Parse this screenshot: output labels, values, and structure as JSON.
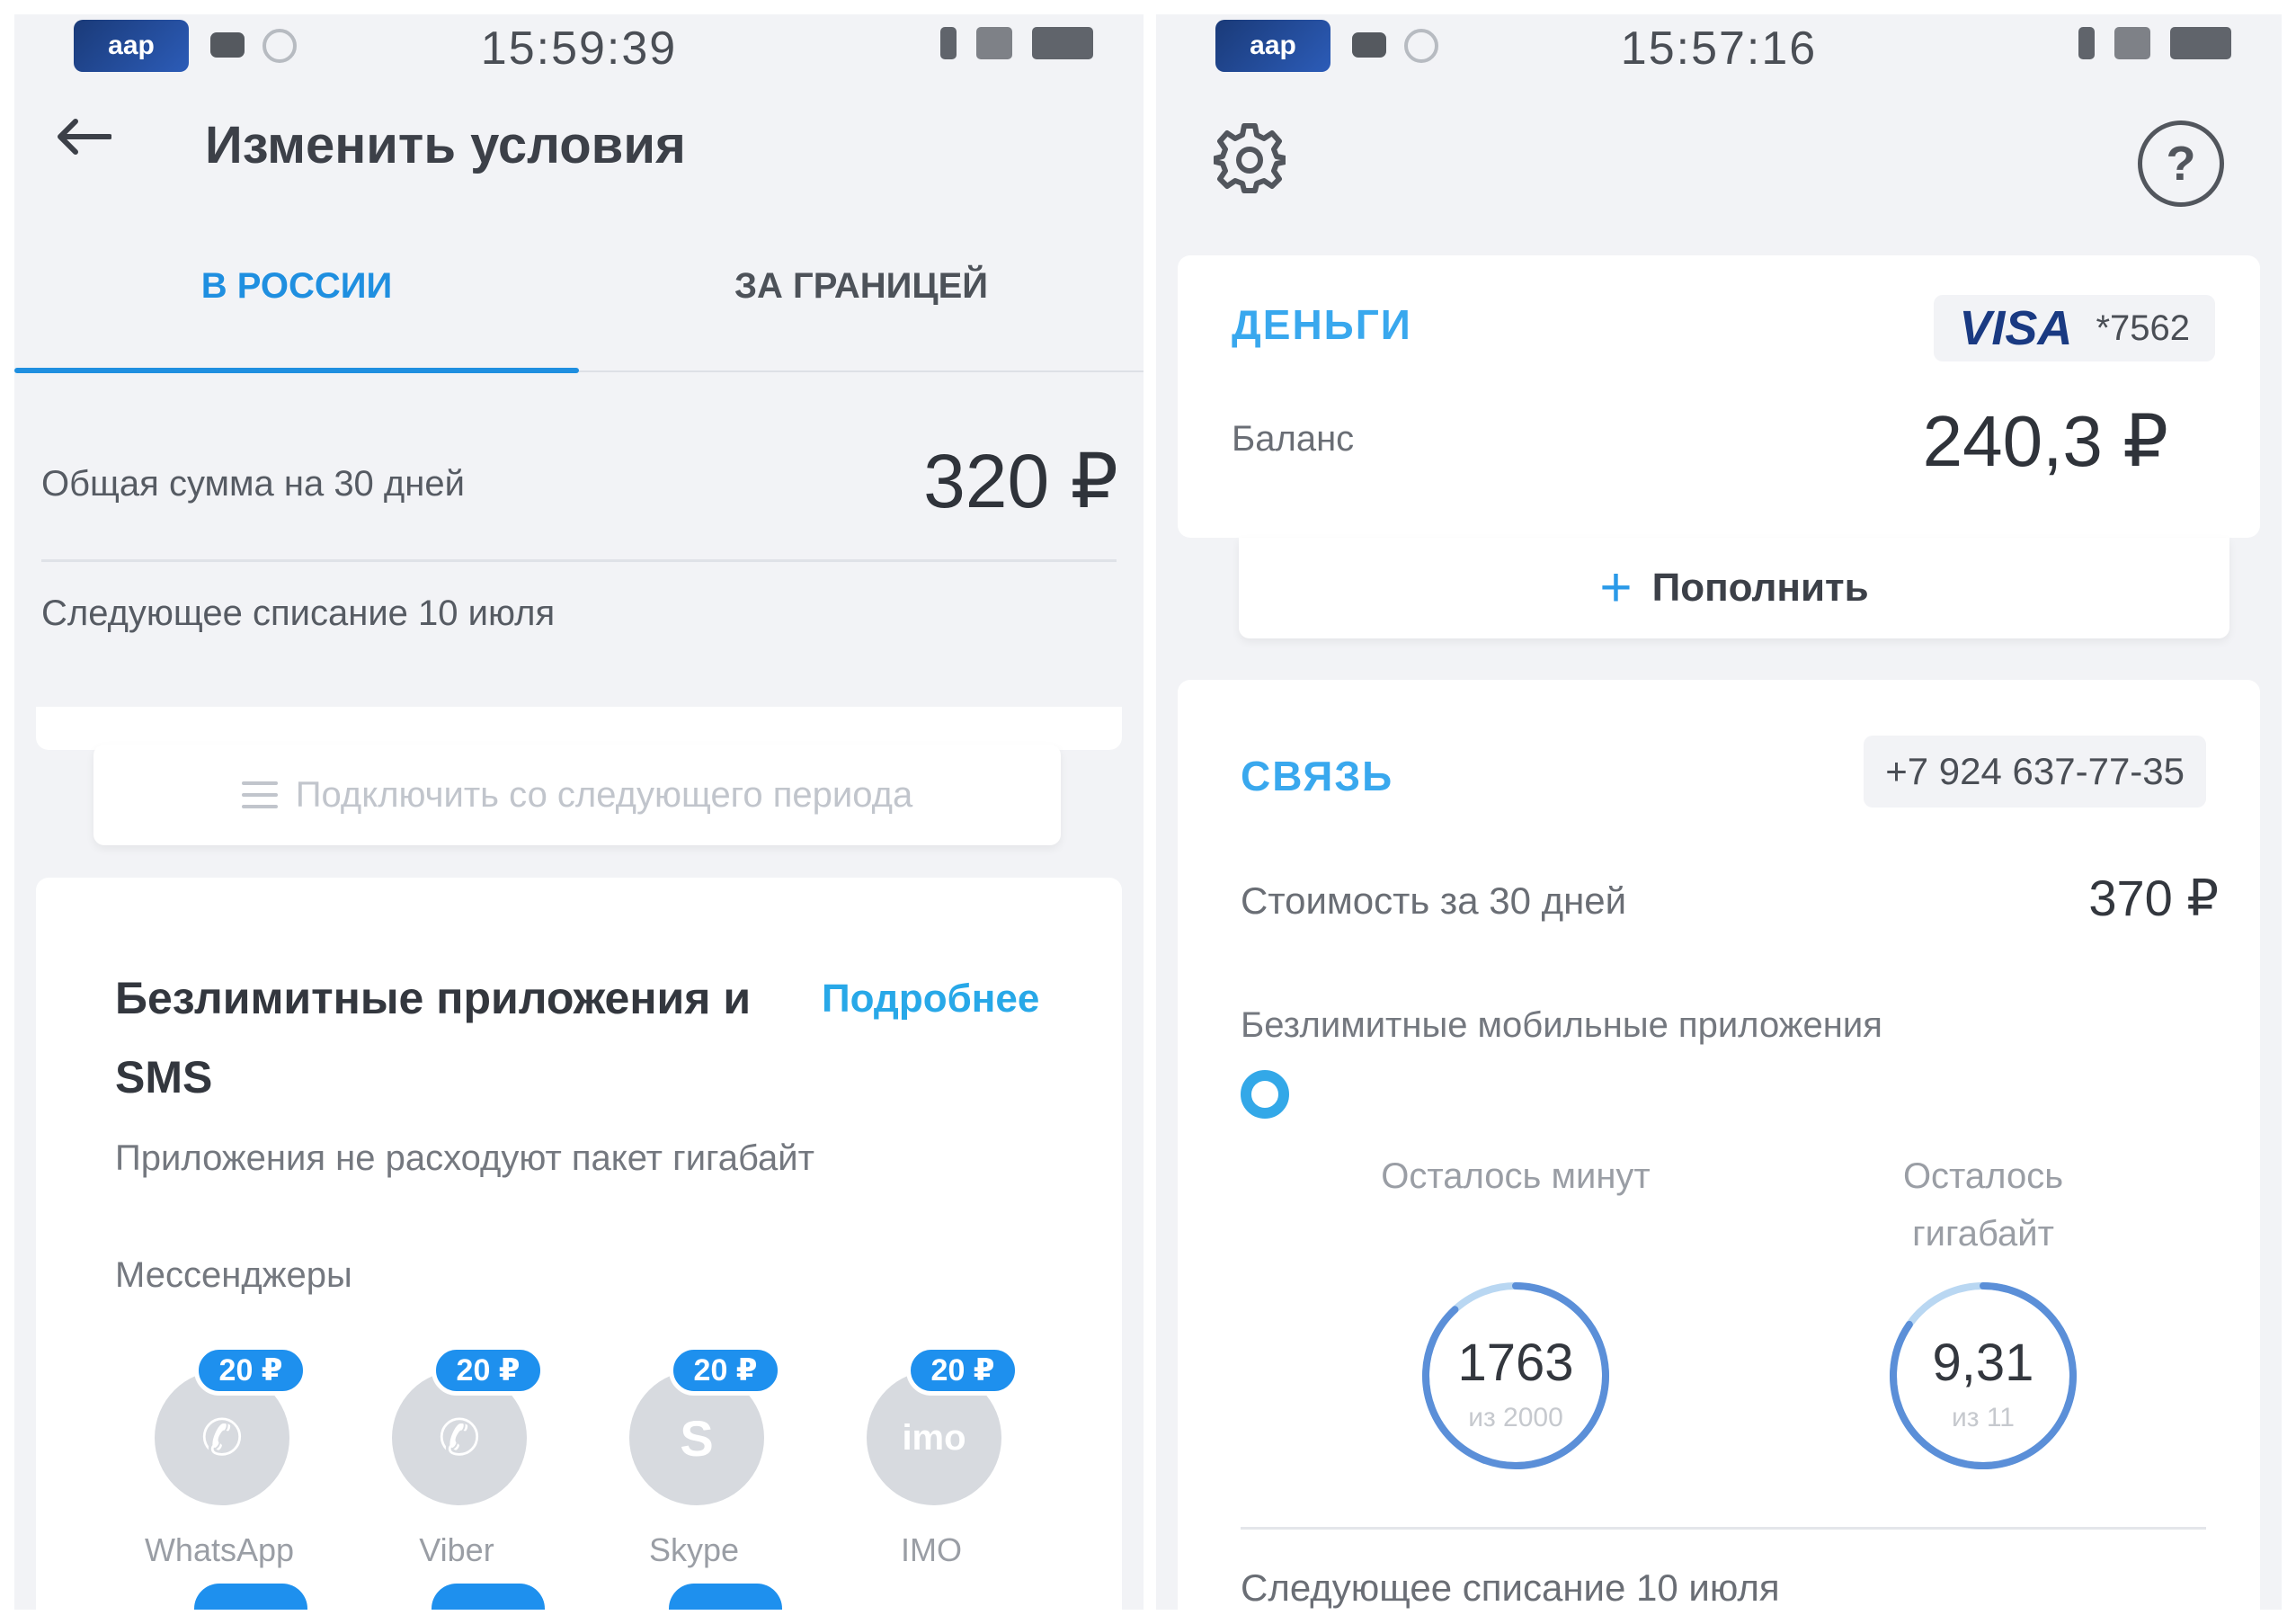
{
  "left": {
    "status_bar": {
      "carrier_badge": "aap",
      "time": "15:59:39"
    },
    "header": {
      "title": "Изменить условия"
    },
    "tabs": [
      {
        "label": "В РОССИИ",
        "active": true
      },
      {
        "label": "ЗА ГРАНИЦЕЙ",
        "active": false
      }
    ],
    "summary": {
      "total_label": "Общая сумма на 30 дней",
      "total_value": "320 ₽",
      "next_charge": "Следующее списание 10 июля"
    },
    "connect_button": {
      "label": "Подключить со следующего периода"
    },
    "apps_card": {
      "title": "Безлимитные приложения и SMS",
      "more_link": "Подробнее",
      "description": "Приложения не расходуют пакет гигабайт",
      "group_label": "Мессенджеры",
      "apps": [
        {
          "name": "WhatsApp",
          "price": "20 ₽",
          "icon": "whatsapp-icon",
          "glyph": "✆"
        },
        {
          "name": "Viber",
          "price": "20 ₽",
          "icon": "viber-icon",
          "glyph": "✆"
        },
        {
          "name": "Skype",
          "price": "20 ₽",
          "icon": "skype-icon",
          "glyph": "S"
        },
        {
          "name": "IMO",
          "price": "20 ₽",
          "icon": "imo-icon",
          "glyph": "imo"
        }
      ]
    }
  },
  "right": {
    "status_bar": {
      "carrier_badge": "aap",
      "time": "15:57:16"
    },
    "toolbar": {
      "settings_icon": "gear-icon",
      "help_icon": "help-icon",
      "help_glyph": "?"
    },
    "money_card": {
      "title": "ДЕНЬГИ",
      "card_brand": "VISA",
      "card_number": "*7562",
      "balance_label": "Баланс",
      "balance_value": "240,3 ₽"
    },
    "topup_button": {
      "label": "Пополнить",
      "icon": "plus-icon",
      "glyph": "+"
    },
    "svyaz_card": {
      "title": "СВЯЗЬ",
      "phone_number": "+7 924 637-77-35",
      "cost_label": "Стоимость за 30 дней",
      "cost_value": "370 ₽",
      "unlim_label": "Безлимитные мобильные приложения",
      "minutes": {
        "label": "Осталось минут",
        "value": "1763",
        "of": "из 2000",
        "remaining": 1763,
        "total": 2000
      },
      "gigabytes": {
        "label": "Осталось гигабайт",
        "value": "9,31",
        "of": "из 11",
        "remaining": 9.31,
        "total": 11
      },
      "next_charge": "Следующее списание 10 июля"
    }
  },
  "colors": {
    "accent_blue": "#1f8fe0",
    "title_blue": "#39a8ee",
    "price_badge": "#1e90ee",
    "ring_blue": "#5b8fd8",
    "ring_light": "#b9d7f2",
    "visa_blue": "#1a3a82",
    "screen_bg": "#f2f3f6"
  }
}
